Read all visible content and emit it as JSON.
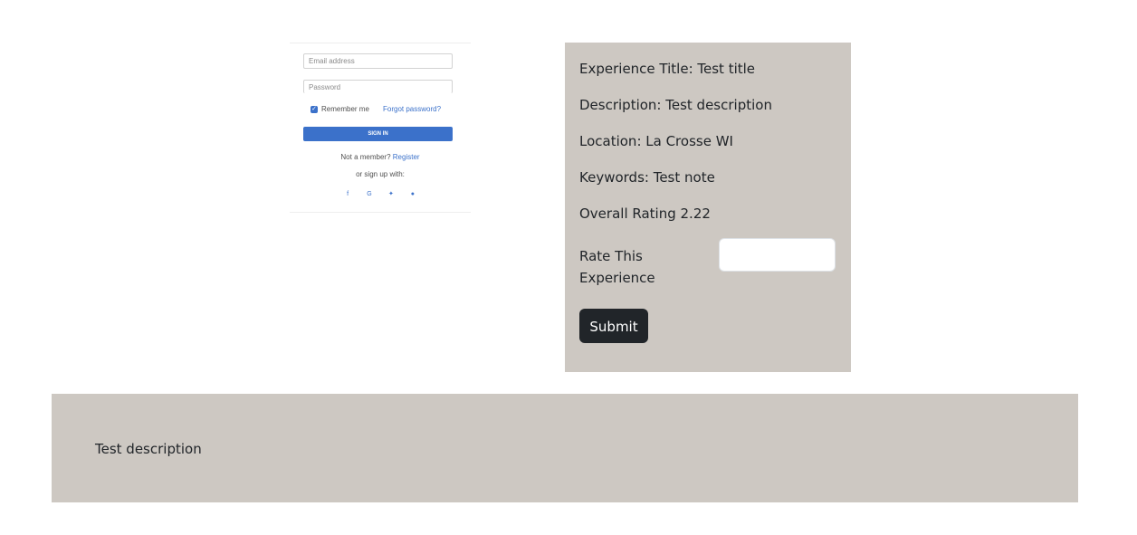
{
  "login": {
    "email_placeholder": "Email address",
    "password_placeholder": "Password",
    "remember_label": "Remember me",
    "forgot_label": "Forgot password?",
    "signin_label": "SIGN IN",
    "not_member": "Not a member?",
    "register_label": "Register",
    "or_signup": "or sign up with:",
    "social_icons": [
      "facebook-icon",
      "google-icon",
      "twitter-icon",
      "github-icon"
    ]
  },
  "experience": {
    "title_line": "Experience Title: Test title",
    "description_line": "Description: Test description",
    "location_line": "Location: La Crosse WI",
    "keywords_line": "Keywords: Test note",
    "rating_line": "Overall Rating 2.22",
    "rate_label": "Rate This Experience",
    "rate_value": "",
    "submit_label": "Submit"
  },
  "description_panel": {
    "text": "Test description"
  },
  "colors": {
    "panel_bg": "#cdc8c2",
    "button_bg": "#212529",
    "accent": "#3b71ca"
  }
}
